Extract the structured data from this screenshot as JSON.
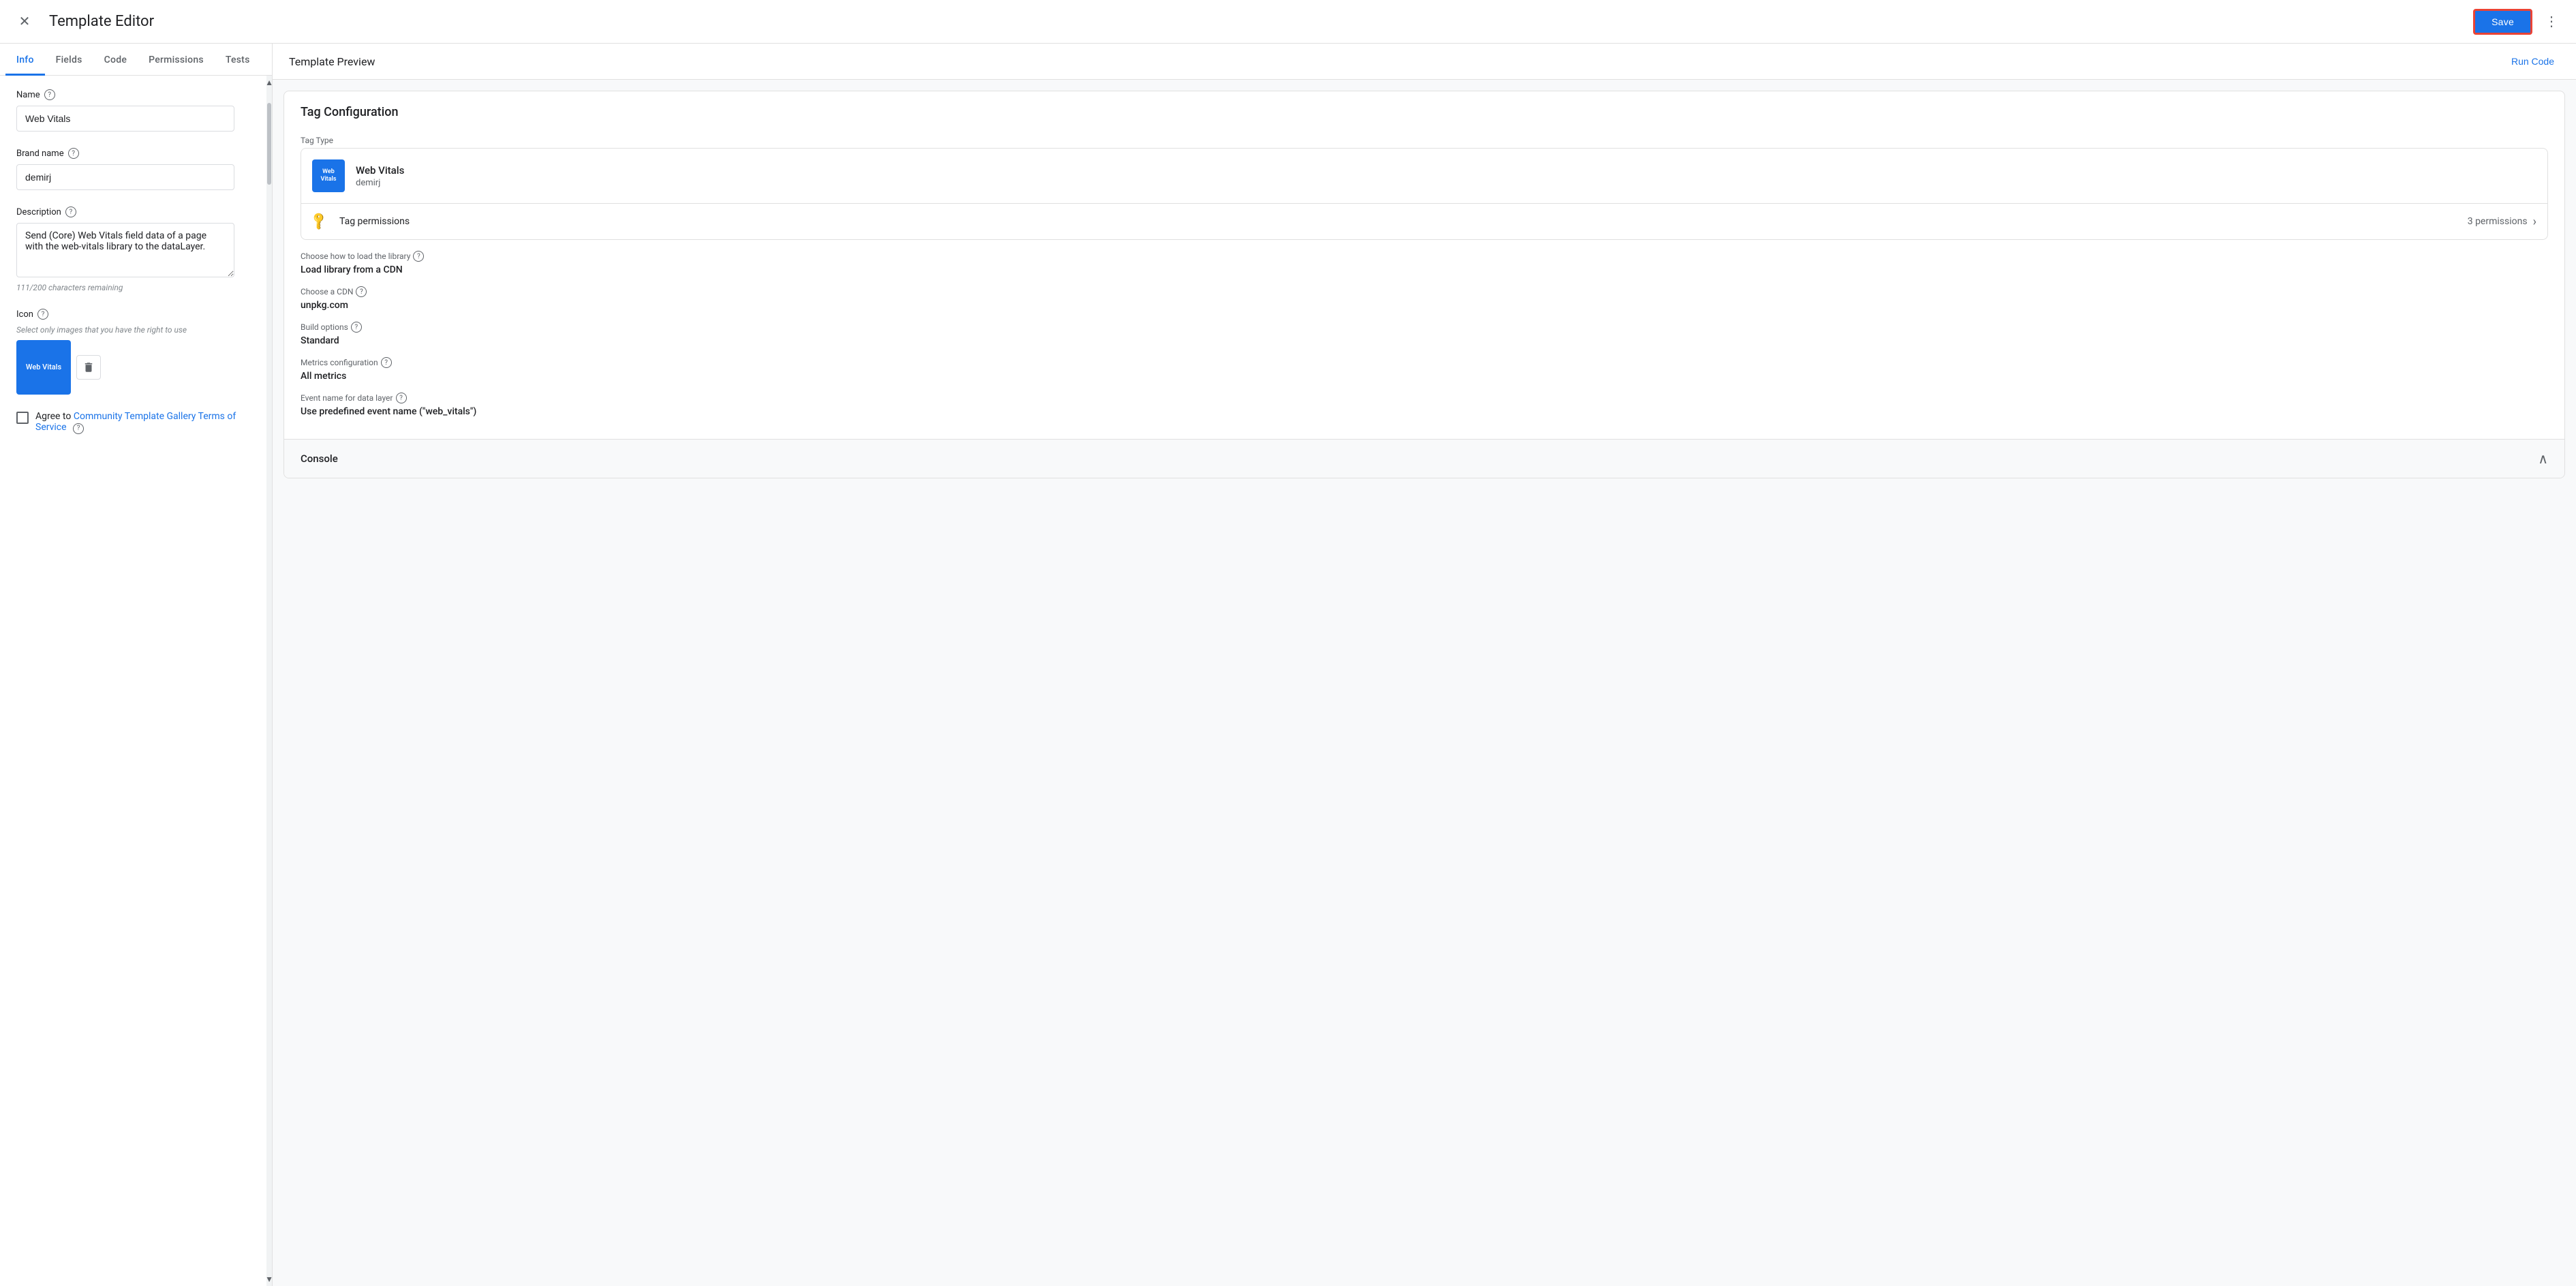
{
  "header": {
    "title": "Template Editor",
    "save_label": "Save",
    "more_icon": "⋮",
    "close_icon": "✕"
  },
  "tabs": [
    {
      "id": "info",
      "label": "Info",
      "active": true
    },
    {
      "id": "fields",
      "label": "Fields",
      "active": false
    },
    {
      "id": "code",
      "label": "Code",
      "active": false
    },
    {
      "id": "permissions",
      "label": "Permissions",
      "active": false
    },
    {
      "id": "tests",
      "label": "Tests",
      "active": false
    }
  ],
  "form": {
    "name_label": "Name",
    "name_value": "Web Vitals",
    "brand_name_label": "Brand name",
    "brand_name_value": "demirj",
    "description_label": "Description",
    "description_value": "Send (Core) Web Vitals field data of a page with the web-vitals library to the dataLayer.",
    "char_count": "111/200 characters remaining",
    "icon_label": "Icon",
    "icon_hint": "Select only images that you have the right to use",
    "icon_text": "Web Vitals",
    "tos_text": "Agree to ",
    "tos_link": "Community Template Gallery Terms of Service"
  },
  "preview": {
    "header": "Template Preview",
    "run_code_label": "Run Code",
    "tag_config_title": "Tag Configuration",
    "tag_type_label": "Tag Type",
    "tag_name": "Web Vitals",
    "tag_brand": "demirj",
    "tag_icon_text": "Web Vitals",
    "permissions_label": "Tag permissions",
    "permissions_count": "3 permissions",
    "library_label": "Choose how to load the library",
    "library_help": true,
    "library_value": "Load library from a CDN",
    "cdn_label": "Choose a CDN",
    "cdn_help": true,
    "cdn_value": "unpkg.com",
    "build_label": "Build options",
    "build_help": true,
    "build_value": "Standard",
    "metrics_label": "Metrics configuration",
    "metrics_help": true,
    "metrics_value": "All metrics",
    "event_label": "Event name for data layer",
    "event_help": true,
    "event_value": "Use predefined event name (\"web_vitals\")",
    "console_title": "Console"
  }
}
